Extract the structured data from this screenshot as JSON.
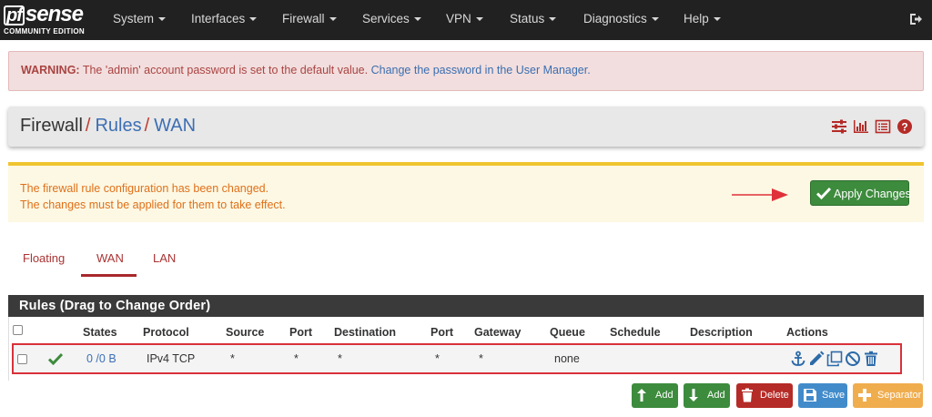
{
  "brand": {
    "logo_main": "sense",
    "logo_pf": "pf",
    "logo_sub": "COMMUNITY EDITION"
  },
  "nav": {
    "items": [
      {
        "label": "System"
      },
      {
        "label": "Interfaces"
      },
      {
        "label": "Firewall"
      },
      {
        "label": "Services"
      },
      {
        "label": "VPN"
      },
      {
        "label": "Status"
      },
      {
        "label": "Diagnostics"
      },
      {
        "label": "Help"
      }
    ],
    "logout_icon": "logout-icon"
  },
  "warning": {
    "prefix": "WARNING:",
    "text": " The 'admin' account password is set to the default value. ",
    "link": "Change the password in the User Manager."
  },
  "breadcrumb": {
    "root": "Firewall",
    "sep": "/",
    "level2": "Rules",
    "level3": "WAN",
    "icons": [
      "sliders-icon",
      "bar-chart-icon",
      "list-icon",
      "help-icon"
    ]
  },
  "config_alert": {
    "line1": "The firewall rule configuration has been changed.",
    "line2": "The changes must be applied for them to take effect.",
    "apply_label": "Apply Changes",
    "accent": "#f0c430"
  },
  "tabs": [
    {
      "label": "Floating"
    },
    {
      "label": "WAN",
      "active": true
    },
    {
      "label": "LAN"
    }
  ],
  "rules": {
    "title": "Rules (Drag to Change Order)",
    "headers": {
      "states": "States",
      "protocol": "Protocol",
      "source": "Source",
      "port": "Port",
      "destination": "Destination",
      "dport": "Port",
      "gateway": "Gateway",
      "queue": "Queue",
      "schedule": "Schedule",
      "description": "Description",
      "actions": "Actions"
    },
    "rows": [
      {
        "states": "0 /0 B",
        "protocol": "IPv4 TCP",
        "source": "*",
        "port": "*",
        "destination": "*",
        "dport": "*",
        "gateway": "*",
        "queue": "none",
        "schedule": "",
        "description": "",
        "actions": [
          "anchor-icon",
          "pencil-icon",
          "copy-icon",
          "disable-icon",
          "trash-icon"
        ]
      }
    ]
  },
  "buttons": {
    "add_top": "Add",
    "add_bottom": "Add",
    "delete": "Delete",
    "save": "Save",
    "separator": "Separator"
  },
  "colors": {
    "navbar": "#212121",
    "danger_bg": "#f2dede",
    "success": "#3d8b3d",
    "danger": "#b52b27",
    "primary": "#428bca",
    "warning": "#f0ad4e",
    "highlight": "#d9313a"
  }
}
